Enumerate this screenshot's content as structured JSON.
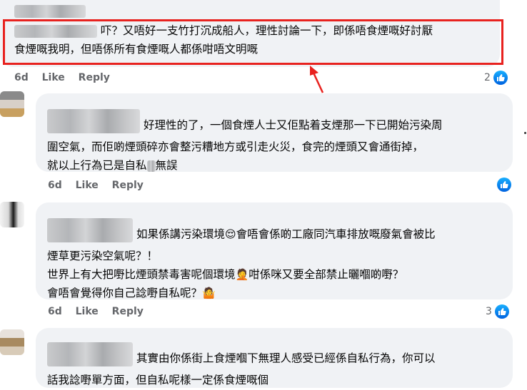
{
  "comments": [
    {
      "text_1": "吓？又唔好一支竹打沉成船人，理性討論一下，即係唔食煙嘅好討厭",
      "text_2": "食煙嘅我明，但唔係所有食煙嘅人都係咁唔文明嘅",
      "time": "6d",
      "like": "Like",
      "reply": "Reply",
      "reaction_count": "2"
    },
    {
      "text_1": "好理性的了，一個食煙人士又佢點着支煙那一下已開始污染周",
      "text_2": "圍空氣，而佢啲煙頭碎亦會整污糟地方或引走火災，食完的煙頭又會通街掉，",
      "text_3a": "就以上行為已是自私",
      "text_3b": "無誤",
      "time": "6d",
      "like": "Like",
      "reply": "Reply",
      "reaction_count": ""
    },
    {
      "text_1": "如果係講污染環境",
      "emoji_1": "😌",
      "text_1b": "會唔會係啲工廠同汽車排放嘅廢氣會被比",
      "text_2": "煙草更污染空氣呢？！",
      "text_3": "世界上有大把嘢比煙頭禁毒害呢個環境",
      "emoji_2": "🤦",
      "text_3b": "咁係咪又要全部禁止曬嗰啲嘢？",
      "text_4": "會唔會覺得你自己諗嘢自私呢？",
      "emoji_3": "🤷",
      "time": "6d",
      "like": "Like",
      "reply": "Reply",
      "reaction_count": "3"
    },
    {
      "text_1": "其實由你係街上食煙嗰下無理人感受已經係自私行為，你可以",
      "text_2": "話我諗嘢單方面，但自私呢樣一定係食煙嘅個",
      "time": "",
      "like": "",
      "reply": "",
      "reaction_count": ""
    }
  ],
  "colors": {
    "highlight": "#e8221f",
    "bubble": "#f0f2f5",
    "like_blue": "#1877f2",
    "meta_grey": "#65676b"
  },
  "icons": {
    "like": "thumbs-up-icon",
    "arrow": "red-arrow-icon"
  }
}
